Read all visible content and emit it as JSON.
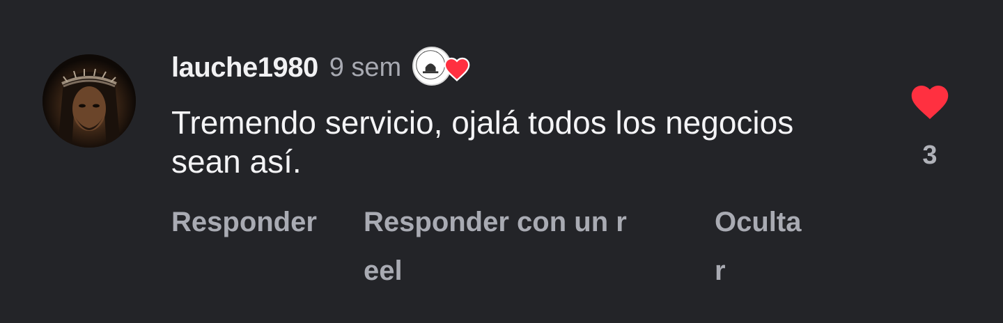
{
  "comment": {
    "username": "lauche1980",
    "time": "9 sem",
    "text": "Tremendo servicio, ojalá todos los negocios sean así.",
    "actions": {
      "reply": "Responder",
      "reply_with_reel": "Responder con un reel",
      "hide": "Ocultar"
    },
    "like_count": "3",
    "like_color": "#ff3040",
    "badge_icon": "creator-liked-badge-icon"
  }
}
